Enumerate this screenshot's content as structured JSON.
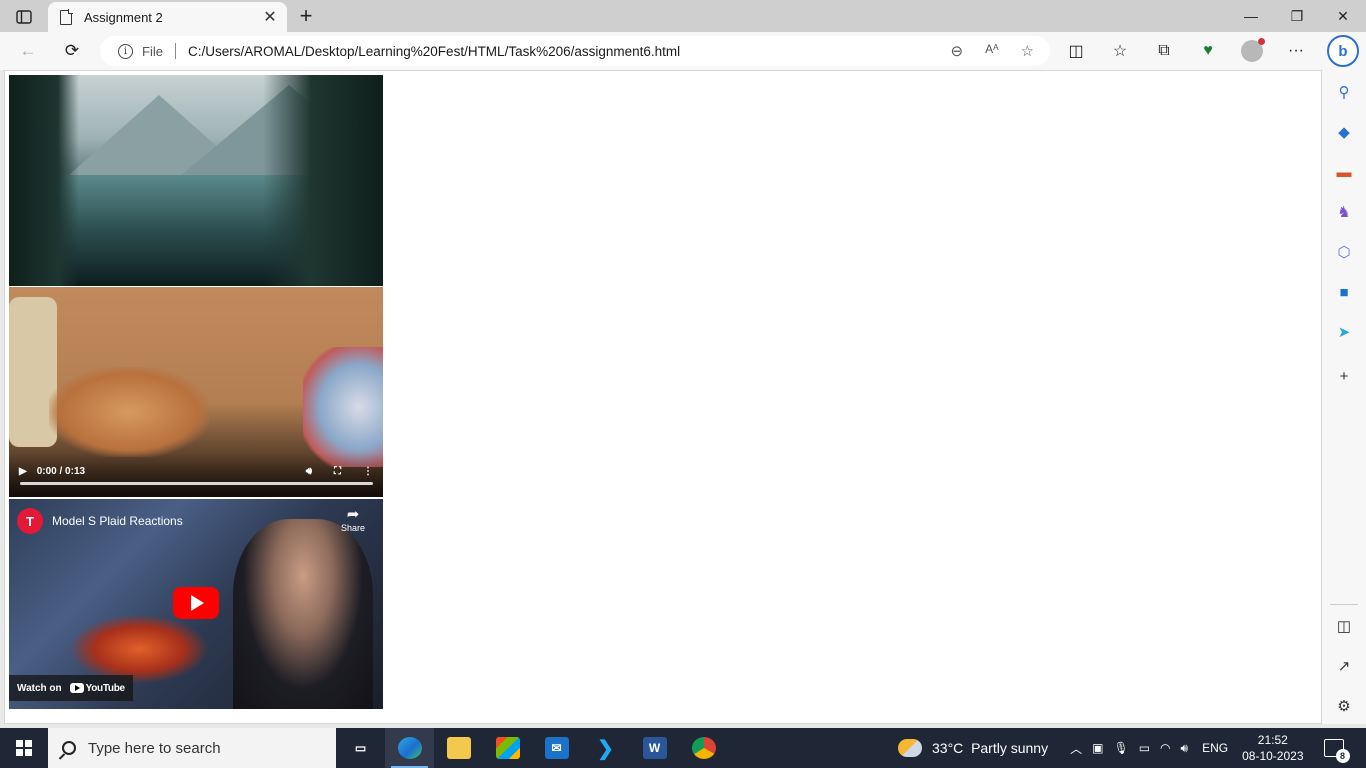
{
  "browser": {
    "tab": {
      "title": "Assignment 2"
    },
    "address_bar": {
      "scheme_label": "File",
      "url": "C:/Users/AROMAL/Desktop/Learning%20Fest/HTML/Task%206/assignment6.html"
    }
  },
  "page": {
    "image": {
      "icon": "lake-landscape-image"
    },
    "video": {
      "time": "0:00 / 0:13",
      "icon": "kitten-video"
    },
    "youtube_embed": {
      "channel_logo": "T",
      "title": "Model S Plaid Reactions",
      "share_label": "Share",
      "watch_on_label": "Watch on",
      "youtube_wordmark": "YouTube"
    }
  },
  "taskbar": {
    "search_placeholder": "Type here to search",
    "weather": {
      "temperature": "33°C",
      "condition": "Partly sunny"
    },
    "language": "ENG",
    "time": "21:52",
    "date": "08-10-2023",
    "notification_count": "8",
    "apps": [
      {
        "name": "Task View",
        "icon": "task-view-icon"
      },
      {
        "name": "Microsoft Edge",
        "icon": "edge-icon"
      },
      {
        "name": "File Explorer",
        "icon": "folder-icon"
      },
      {
        "name": "Microsoft Store",
        "icon": "store-icon"
      },
      {
        "name": "Mail",
        "icon": "mail-icon"
      },
      {
        "name": "Visual Studio Code",
        "icon": "vscode-icon"
      },
      {
        "name": "Word",
        "icon": "word-icon",
        "glyph": "W"
      },
      {
        "name": "Google Chrome",
        "icon": "chrome-icon"
      }
    ]
  },
  "colors": {
    "accent": "#2a6fd6",
    "taskbar_bg": "#1f2636",
    "youtube_red": "#ff0000",
    "tesla_red": "#e31937"
  }
}
